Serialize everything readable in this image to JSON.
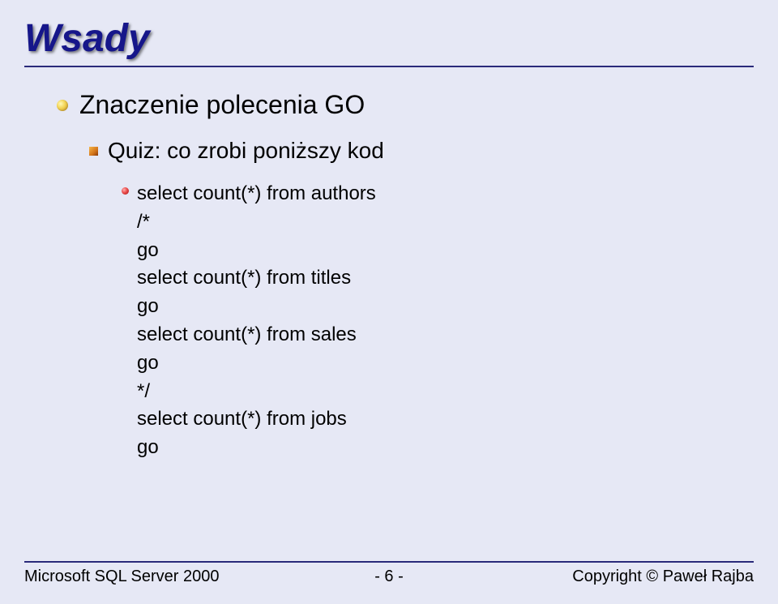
{
  "title": "Wsady",
  "level1": "Znaczenie polecenia GO",
  "level2": "Quiz: co zrobi poniższy kod",
  "code": "select count(*) from authors\n/*\ngo\nselect count(*) from titles\ngo\nselect count(*) from sales\ngo\n*/\nselect count(*) from jobs\ngo",
  "footer": {
    "left": "Microsoft SQL Server 2000",
    "center": "- 6 -",
    "right": "Copyright © Paweł Rajba"
  }
}
